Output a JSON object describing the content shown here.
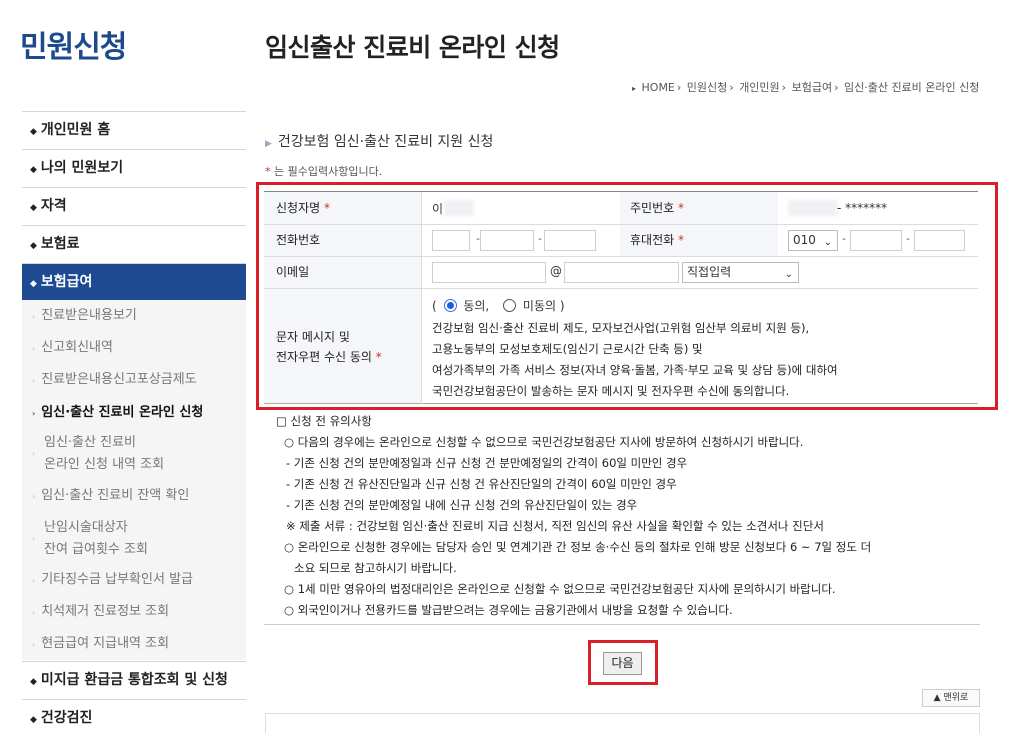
{
  "sidebar": {
    "title": "민원신청",
    "main_items": [
      {
        "label": "개인민원 홈"
      },
      {
        "label": "나의 민원보기"
      },
      {
        "label": "자격"
      },
      {
        "label": "보험료"
      },
      {
        "label": "보험급여"
      },
      {
        "label": "미지급 환급금 통합조회 및 신청"
      },
      {
        "label": "건강검진"
      }
    ],
    "sub_items": [
      {
        "label": "진료받은내용보기"
      },
      {
        "label": "신고회신내역"
      },
      {
        "label": "진료받은내용신고포상금제도"
      },
      {
        "label": "임신·출산 진료비 온라인 신청"
      },
      {
        "line1": "임신·출산 진료비",
        "line2": "온라인 신청 내역 조회"
      },
      {
        "label": "임신·출산 진료비 잔액 확인"
      },
      {
        "line1": "난임시술대상자",
        "line2": "잔여 급여횟수 조회"
      },
      {
        "label": "기타징수금 납부확인서 발급"
      },
      {
        "label": "치석제거 진료정보 조회"
      },
      {
        "label": "현금급여 지급내역 조회"
      }
    ]
  },
  "header": {
    "title": "임신출산 진료비 온라인 신청",
    "breadcrumb": [
      "HOME",
      "민원신청",
      "개인민원",
      "보험급여",
      "임신·출산 진료비 온라인 신청"
    ],
    "section_title": "건강보험 임신·출산 진료비 지원 신청",
    "required_note": "는 필수입력사항입니다.",
    "required_mark": "*"
  },
  "form": {
    "applicant_label": "신청자명",
    "applicant_value": "이",
    "rrn_label": "주민번호",
    "rrn_value": "- *******",
    "phone_label": "전화번호",
    "mobile_label": "휴대전화",
    "mobile_prefix": "010",
    "email_label": "이메일",
    "email_at": "@",
    "email_domain_select": "직접입력",
    "consent_label_1": "문자 메시지 및",
    "consent_label_2": "전자우편 수신 동의",
    "consent_open": "(",
    "consent_yes": "동의,",
    "consent_no": "미동의 )",
    "consent_lines": [
      "건강보험 임신·출산 진료비 제도, 모자보건사업(고위험 임산부 의료비 지원 등),",
      "고용노동부의 모성보호제도(임신기 근로시간 단축 등) 및",
      "여성가족부의 가족 서비스 정보(자녀 양육·돌봄, 가족·부모 교육 및 상담 등)에 대하여",
      "국민건강보험공단이 발송하는 문자 메시지 및 전자우편 수신에 동의합니다."
    ]
  },
  "notice": {
    "heading": "□ 신청 전 유의사항",
    "lines": [
      "○ 다음의 경우에는 온라인으로 신청할 수 없으므로 국민건강보험공단 지사에 방문하여 신청하시기 바랍니다.",
      "- 기존 신청 건의 분만예정일과 신규 신청 건 분만예정일의 간격이 60일 미만인 경우",
      "- 기존 신청 건 유산진단일과 신규 신청 건 유산진단일의 간격이 60일 미만인 경우",
      "- 기존 신청 건의 분만예정일 내에 신규 신청 건의 유산진단일이 있는 경우",
      "※ 제출 서류 : 건강보험 임신·출산 진료비 지급 신청서, 직전 임신의 유산 사실을 확인할 수 있는 소견서나 진단서",
      "○ 온라인으로 신청한 경우에는 담당자 승인 및 연계기관 간 정보 송·수신 등의 절차로 인해 방문 신청보다 6 ~ 7일 정도 더",
      "소요 되므로 참고하시기 바랍니다.",
      "○ 1세 미만 영유아의 법정대리인은 온라인으로 신청할 수 없으므로 국민건강보험공단 지사에 문의하시기 바랍니다.",
      "○ 외국인이거나 전용카드를 발급받으려는 경우에는 금융기관에서 내방을 요청할 수 있습니다."
    ]
  },
  "buttons": {
    "next": "다음",
    "top": "맨위로"
  },
  "colors": {
    "brand_blue": "#1d4a91",
    "highlight_red": "#d7202a",
    "required_red": "#c2322c"
  }
}
